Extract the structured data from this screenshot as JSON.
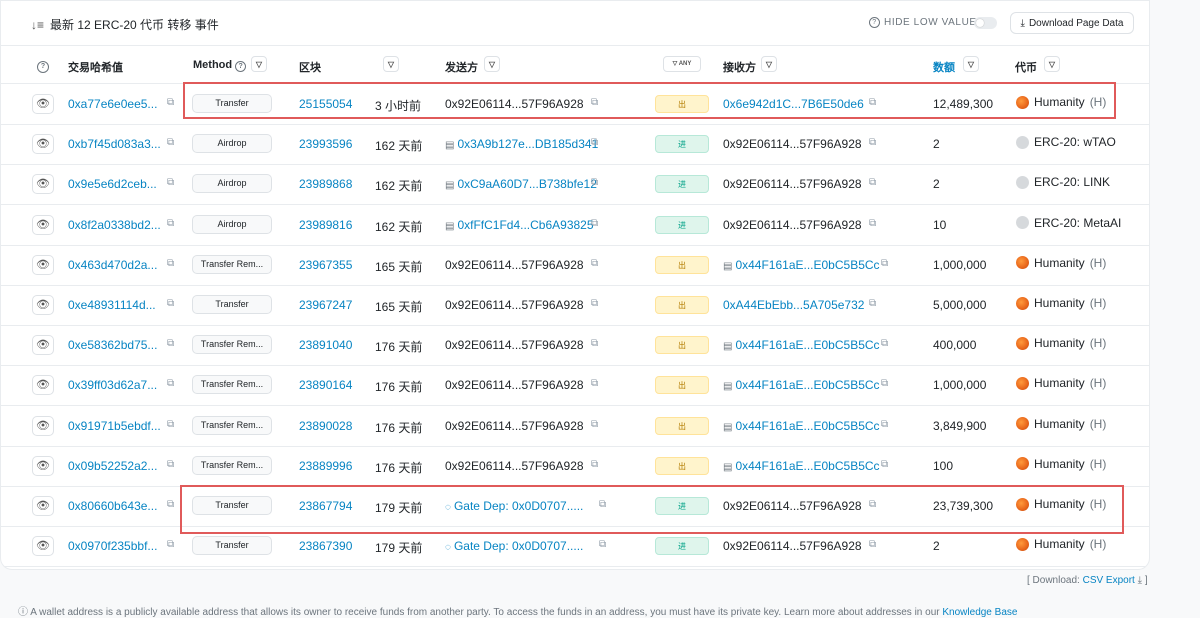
{
  "header": {
    "title": "最新 12 ERC-20 代币 转移 事件",
    "hide_low_value": "HIDE LOW VALUE",
    "download_button": "Download Page Data"
  },
  "columns": {
    "tx_hash": "交易哈希值",
    "method": "Method",
    "block": "区块",
    "from": "发送方",
    "any": "ANY",
    "to": "接收方",
    "amount": "数额",
    "token": "代币"
  },
  "rows": [
    {
      "hash": "0xa77e6e0ee5...",
      "method": "Transfer",
      "block": "25155054",
      "age": "3 小时前",
      "from": "0x92E06114...57F96A928",
      "from_link": false,
      "from_doc": false,
      "dir": "出",
      "to": "0x6e942d1C...7B6E50de6",
      "to_link": true,
      "to_doc": false,
      "amount": "12,489,300",
      "token_name": "Humanity",
      "token_sym": "(H)",
      "token_icon": "humanity"
    },
    {
      "hash": "0xb7f45d083a3...",
      "method": "Airdrop",
      "block": "23993596",
      "age": "162 天前",
      "from": "0x3A9b127e...DB185d341",
      "from_link": true,
      "from_doc": true,
      "dir": "进",
      "to": "0x92E06114...57F96A928",
      "to_link": false,
      "to_doc": false,
      "amount": "2",
      "token_name": "ERC-20: wTAO",
      "token_sym": "",
      "token_icon": "erc20"
    },
    {
      "hash": "0x9e5e6d2ceb...",
      "method": "Airdrop",
      "block": "23989868",
      "age": "162 天前",
      "from": "0xC9aA60D7...B738bfe12",
      "from_link": true,
      "from_doc": true,
      "dir": "进",
      "to": "0x92E06114...57F96A928",
      "to_link": false,
      "to_doc": false,
      "amount": "2",
      "token_name": "ERC-20: LINK",
      "token_sym": "",
      "token_icon": "erc20"
    },
    {
      "hash": "0x8f2a0338bd2...",
      "method": "Airdrop",
      "block": "23989816",
      "age": "162 天前",
      "from": "0xfFfC1Fd4...Cb6A93825",
      "from_link": true,
      "from_doc": true,
      "dir": "进",
      "to": "0x92E06114...57F96A928",
      "to_link": false,
      "to_doc": false,
      "amount": "10",
      "token_name": "ERC-20: MetaAI",
      "token_sym": "",
      "token_icon": "erc20"
    },
    {
      "hash": "0x463d470d2a...",
      "method": "Transfer Rem...",
      "block": "23967355",
      "age": "165 天前",
      "from": "0x92E06114...57F96A928",
      "from_link": false,
      "from_doc": false,
      "dir": "出",
      "to": "0x44F161aE...E0bC5B5Cc",
      "to_link": true,
      "to_doc": true,
      "amount": "1,000,000",
      "token_name": "Humanity",
      "token_sym": "(H)",
      "token_icon": "humanity"
    },
    {
      "hash": "0xe48931114d...",
      "method": "Transfer",
      "block": "23967247",
      "age": "165 天前",
      "from": "0x92E06114...57F96A928",
      "from_link": false,
      "from_doc": false,
      "dir": "出",
      "to": "0xA44EbEbb...5A705e732",
      "to_link": true,
      "to_doc": false,
      "amount": "5,000,000",
      "token_name": "Humanity",
      "token_sym": "(H)",
      "token_icon": "humanity"
    },
    {
      "hash": "0xe58362bd75...",
      "method": "Transfer Rem...",
      "block": "23891040",
      "age": "176 天前",
      "from": "0x92E06114...57F96A928",
      "from_link": false,
      "from_doc": false,
      "dir": "出",
      "to": "0x44F161aE...E0bC5B5Cc",
      "to_link": true,
      "to_doc": true,
      "amount": "400,000",
      "token_name": "Humanity",
      "token_sym": "(H)",
      "token_icon": "humanity"
    },
    {
      "hash": "0x39ff03d62a7...",
      "method": "Transfer Rem...",
      "block": "23890164",
      "age": "176 天前",
      "from": "0x92E06114...57F96A928",
      "from_link": false,
      "from_doc": false,
      "dir": "出",
      "to": "0x44F161aE...E0bC5B5Cc",
      "to_link": true,
      "to_doc": true,
      "amount": "1,000,000",
      "token_name": "Humanity",
      "token_sym": "(H)",
      "token_icon": "humanity"
    },
    {
      "hash": "0x91971b5ebdf...",
      "method": "Transfer Rem...",
      "block": "23890028",
      "age": "176 天前",
      "from": "0x92E06114...57F96A928",
      "from_link": false,
      "from_doc": false,
      "dir": "出",
      "to": "0x44F161aE...E0bC5B5Cc",
      "to_link": true,
      "to_doc": true,
      "amount": "3,849,900",
      "token_name": "Humanity",
      "token_sym": "(H)",
      "token_icon": "humanity"
    },
    {
      "hash": "0x09b52252a2...",
      "method": "Transfer Rem...",
      "block": "23889996",
      "age": "176 天前",
      "from": "0x92E06114...57F96A928",
      "from_link": false,
      "from_doc": false,
      "dir": "出",
      "to": "0x44F161aE...E0bC5B5Cc",
      "to_link": true,
      "to_doc": true,
      "amount": "100",
      "token_name": "Humanity",
      "token_sym": "(H)",
      "token_icon": "humanity"
    },
    {
      "hash": "0x80660b643e...",
      "method": "Transfer",
      "block": "23867794",
      "age": "179 天前",
      "from": "Gate Dep: 0x0D0707.....",
      "from_link": true,
      "from_doc": false,
      "from_gate": true,
      "dir": "进",
      "to": "0x92E06114...57F96A928",
      "to_link": false,
      "to_doc": false,
      "amount": "23,739,300",
      "token_name": "Humanity",
      "token_sym": "(H)",
      "token_icon": "humanity"
    },
    {
      "hash": "0x0970f235bbf...",
      "method": "Transfer",
      "block": "23867390",
      "age": "179 天前",
      "from": "Gate Dep: 0x0D0707.....",
      "from_link": true,
      "from_doc": false,
      "from_gate": true,
      "dir": "进",
      "to": "0x92E06114...57F96A928",
      "to_link": false,
      "to_doc": false,
      "amount": "2",
      "token_name": "Humanity",
      "token_sym": "(H)",
      "token_icon": "humanity"
    }
  ],
  "footer": {
    "download_prefix": "[ Download:",
    "csv_link": "CSV Export",
    "download_suffix": "]",
    "note": "A wallet address is a publicly available address that allows its owner to receive funds from another party. To access the funds in an address, you must have its private key. Learn more about addresses in our",
    "knowledge_base": "Knowledge Base"
  },
  "colors": {
    "link": "#0784c3",
    "highlight": "#e05a5a",
    "out_badge": "#fff4cc",
    "in_badge": "#dff5ec"
  }
}
